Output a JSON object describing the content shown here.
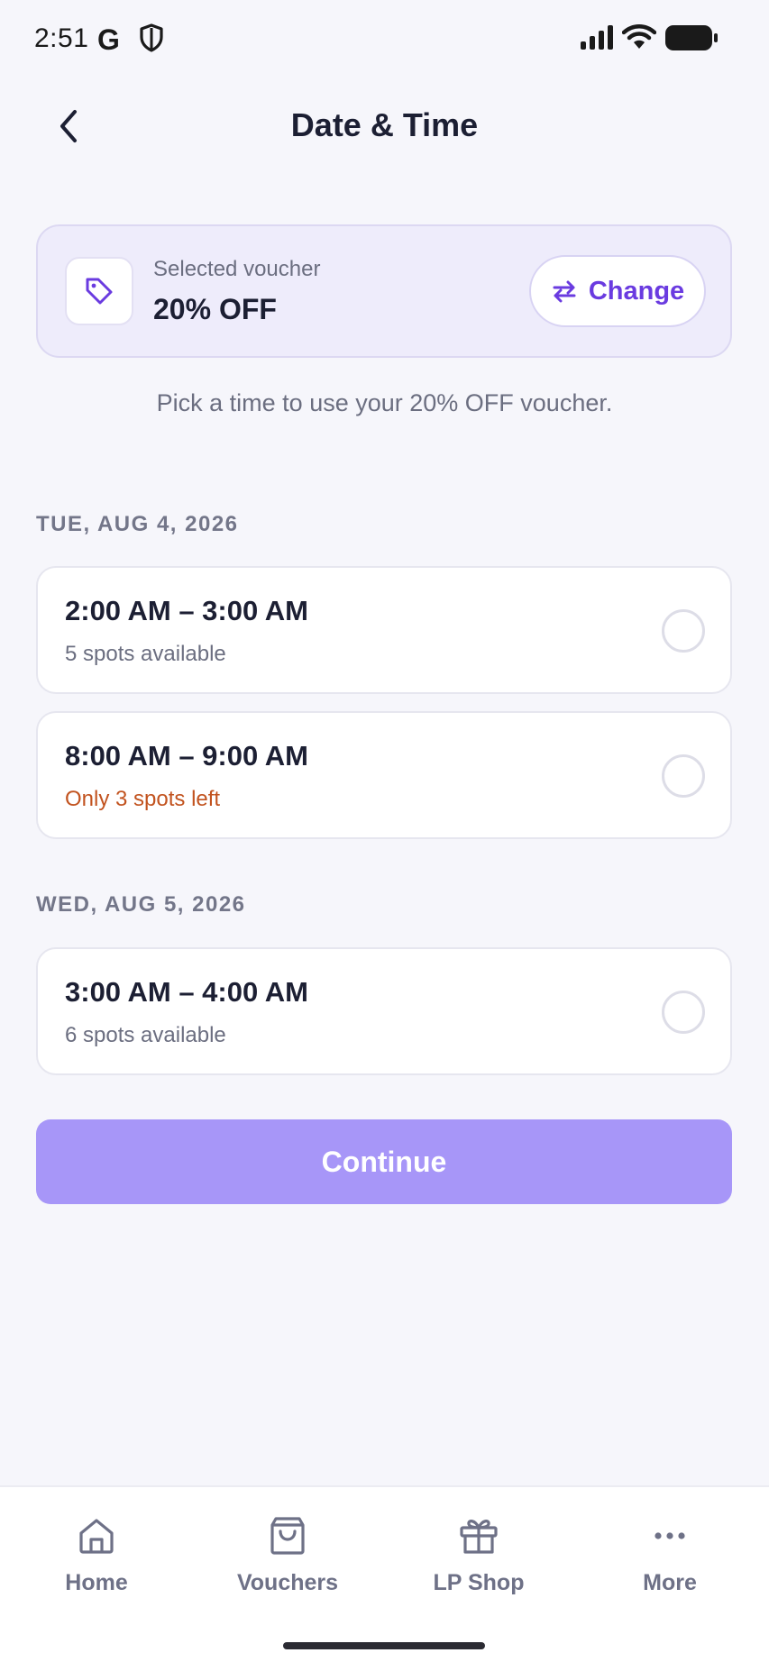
{
  "status_bar": {
    "time": "2:51",
    "g_label": "G"
  },
  "header": {
    "title": "Date & Time",
    "back_icon": "chevron-left-icon"
  },
  "voucher": {
    "label": "Selected voucher",
    "value": "20% OFF",
    "icon": "tag-icon",
    "change_label": "Change",
    "change_icon": "swap-icon"
  },
  "helper_text": "Pick a time to use your 20% OFF voucher.",
  "days": [
    {
      "header": "TUE, AUG 4, 2026",
      "slots": [
        {
          "time": "2:00 AM – 3:00 AM",
          "spots": "5 spots available",
          "low": false
        },
        {
          "time": "8:00 AM – 9:00 AM",
          "spots": "Only 3 spots left",
          "low": true
        }
      ]
    },
    {
      "header": "WED, AUG 5, 2026",
      "slots": [
        {
          "time": "3:00 AM – 4:00 AM",
          "spots": "6 spots available",
          "low": false
        }
      ]
    }
  ],
  "continue_label": "Continue",
  "nav": [
    {
      "label": "Home",
      "icon": "home-icon"
    },
    {
      "label": "Vouchers",
      "icon": "shopping-bag-icon"
    },
    {
      "label": "LP Shop",
      "icon": "gift-icon"
    },
    {
      "label": "More",
      "icon": "more-dots-icon"
    }
  ],
  "colors": {
    "accent": "#6a3be0",
    "continue_disabled": "#a796f8",
    "warning": "#c2531f",
    "background": "#f6f6fb"
  }
}
